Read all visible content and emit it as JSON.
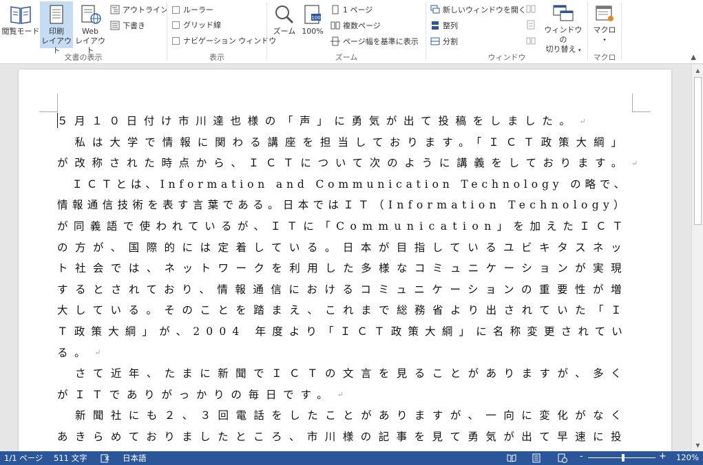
{
  "ribbon": {
    "groups": {
      "views": {
        "label": "文書の表示",
        "read_mode": "閲覧モード",
        "print_layout_1": "印刷",
        "print_layout_2": "レイアウト",
        "web_layout_1": "Web",
        "web_layout_2": "レイアウト",
        "outline": "アウトライン",
        "draft": "下書き"
      },
      "show": {
        "label": "表示",
        "ruler": "ルーラー",
        "gridlines": "グリッド線",
        "nav_pane": "ナビゲーション ウィンドウ"
      },
      "zoom": {
        "label": "ズーム",
        "zoom": "ズーム",
        "hundred": "100%",
        "one_page": "1 ページ",
        "multi_page": "複数ページ",
        "page_width": "ページ幅を基準に表示"
      },
      "window": {
        "label": "ウィンドウ",
        "new_window": "新しいウィンドウを開く",
        "arrange": "整列",
        "split": "分割",
        "switch_1": "ウィンドウの",
        "switch_2": "切り替え"
      },
      "macros": {
        "label": "マクロ",
        "macros": "マクロ"
      }
    }
  },
  "document": {
    "lines": [
      {
        "text": "５月１０日付け市川達也様の「声」に勇気が出て投稿をしました。",
        "mark": true
      },
      {
        "text": "　私は大学で情報に関わる講座を担当しております。「ＩＣＴ政策大綱」",
        "mark": false
      },
      {
        "text": "が改称された時点から、ＩＣＴについて次のように講義をしております。",
        "mark": true
      },
      {
        "text": "　ＩＣＴとは、Information and Communication Technology の略で、",
        "mark": false
      },
      {
        "text": "情報通信技術を表す言葉である。日本ではＩＴ（Information Technology）",
        "mark": false
      },
      {
        "text": "が同義語で使われているが、ＩＴに「Communication」を加えたＩＣＴ",
        "mark": false
      },
      {
        "text": "の方が、国際的には定着している。日本が目指しているユビキタスネッ",
        "mark": false
      },
      {
        "text": "ト社会では、ネットワークを利用した多様なコミュニケーションが実現",
        "mark": false
      },
      {
        "text": "するとされており、情報通信におけるコミュニケーションの重要性が増",
        "mark": false
      },
      {
        "text": "大している。そのことを踏まえ、これまで総務省より出されていた「Ｉ",
        "mark": false
      },
      {
        "text": "Ｔ政策大綱」が、2004 年度より「ＩＣＴ政策大綱」に名称変更されてい",
        "mark": false
      },
      {
        "text": "る。",
        "mark": true
      },
      {
        "text": "　さて近年、たまに新聞でＩＣＴの文言を見ることがありますが、多く",
        "mark": false
      },
      {
        "text": "がＩＴでありがっかりの毎日です。",
        "mark": true
      },
      {
        "text": "　新聞社にも２、３回電話をしたことがありますが、一向に変化がなく",
        "mark": false
      },
      {
        "text": "あきらめておりましたところ、市川様の記事を見て勇気が出て早速に投",
        "mark": false
      }
    ],
    "para_mark_glyph": "↵"
  },
  "status": {
    "page": "1/1 ページ",
    "words": "511 文字",
    "language": "日本語",
    "zoom_percent": "120%",
    "zoom_minus": "-",
    "zoom_plus": "+"
  },
  "colors": {
    "status_bg": "#2b579a",
    "selected_btn": "#c5dcf2"
  }
}
